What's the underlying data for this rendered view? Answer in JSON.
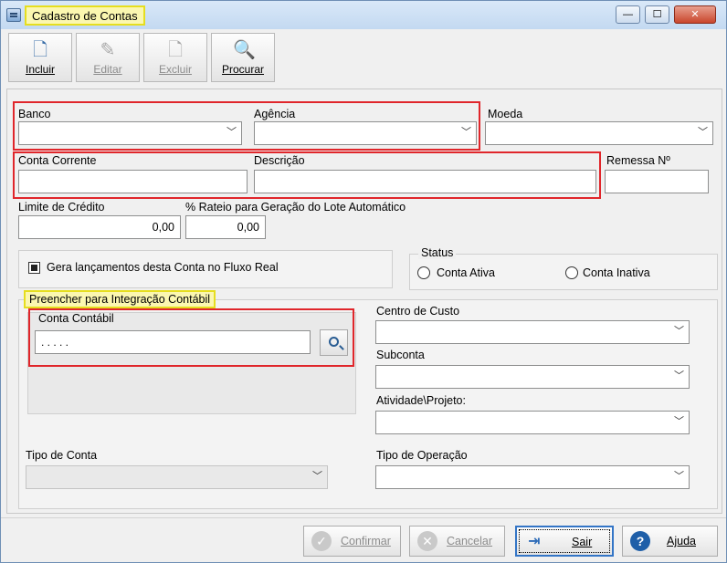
{
  "window": {
    "title": "Cadastro de Contas"
  },
  "toolbar": {
    "buttons": [
      {
        "label": "Incluir",
        "enabled": true,
        "icon": "new-document-icon"
      },
      {
        "label": "Editar",
        "enabled": false,
        "icon": "edit-document-icon"
      },
      {
        "label": "Excluir",
        "enabled": false,
        "icon": "delete-document-icon"
      },
      {
        "label": "Procurar",
        "enabled": true,
        "icon": "search-document-icon"
      }
    ]
  },
  "form": {
    "banco": {
      "label": "Banco",
      "value": ""
    },
    "agencia": {
      "label": "Agência",
      "value": ""
    },
    "moeda": {
      "label": "Moeda",
      "value": ""
    },
    "conta_corrente": {
      "label": "Conta Corrente",
      "value": ""
    },
    "descricao": {
      "label": "Descrição",
      "value": ""
    },
    "remessa": {
      "label": "Remessa Nº",
      "value": ""
    },
    "limite_credito": {
      "label": "Limite de Crédito",
      "value": "0,00"
    },
    "rateio": {
      "label": "% Rateio para Geração do Lote Automático",
      "value": "0,00"
    },
    "fluxo_real": {
      "label": "Gera lançamentos desta Conta no Fluxo Real",
      "checked": true
    },
    "status": {
      "label": "Status",
      "options": [
        "Conta Ativa",
        "Conta Inativa"
      ]
    },
    "integracao": {
      "label": "Preencher para Integração Contábil",
      "conta_contabil": {
        "label": "Conta Contábil",
        "value": ". . . . ."
      }
    },
    "centro_custo": {
      "label": "Centro de Custo",
      "value": ""
    },
    "subconta": {
      "label": "Subconta",
      "value": ""
    },
    "atividade": {
      "label": "Atividade\\Projeto:",
      "value": ""
    },
    "tipo_conta": {
      "label": "Tipo de Conta",
      "value": ""
    },
    "tipo_operacao": {
      "label": "Tipo de Operação",
      "value": ""
    }
  },
  "footer": {
    "confirmar": "Confirmar",
    "cancelar": "Cancelar",
    "sair": "Sair",
    "ajuda": "Ajuda"
  },
  "colors": {
    "highlight_red": "#e0262b",
    "highlight_yellow": "#fbf7b0",
    "accent": "#3375c6"
  }
}
